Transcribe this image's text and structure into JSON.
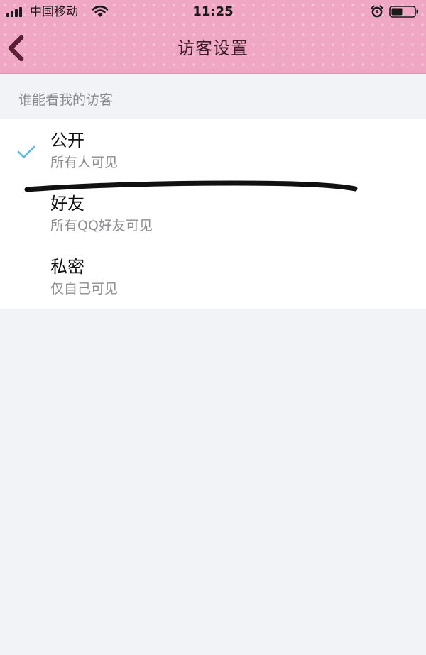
{
  "status_bar": {
    "carrier": "中国移动",
    "time": "11:25",
    "icons": [
      "signal-icon",
      "wifi-icon",
      "alarm-icon",
      "battery-icon"
    ]
  },
  "nav": {
    "back_icon": "chevron-left-icon",
    "title": "访客设置"
  },
  "section": {
    "label": "谁能看我的访客"
  },
  "options": [
    {
      "title": "公开",
      "description": "所有人可见",
      "selected": true
    },
    {
      "title": "好友",
      "description": "所有QQ好友可见",
      "selected": false
    },
    {
      "title": "私密",
      "description": "仅自己可见",
      "selected": false
    }
  ],
  "colors": {
    "header_pink": "#f0a7c4",
    "check_blue": "#5bb8e6",
    "title_text": "#3c1a26",
    "back_arrow": "#5a1f33"
  }
}
